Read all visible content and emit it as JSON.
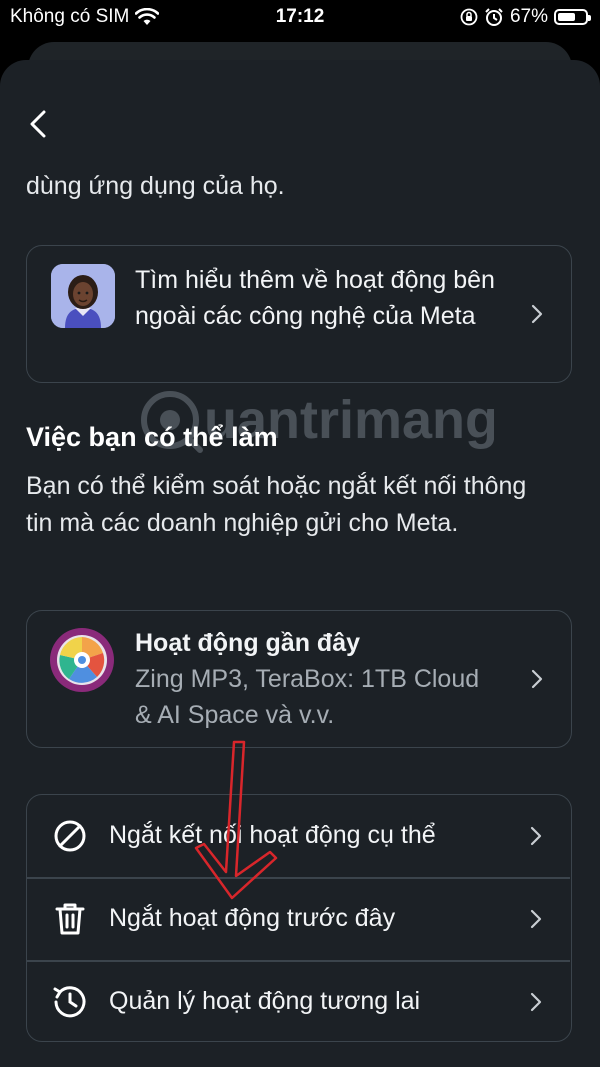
{
  "status_bar": {
    "carrier": "Không có SIM",
    "time": "17:12",
    "battery_percent": "67%",
    "battery_level": 0.67,
    "icons": [
      "wifi-icon",
      "rotation-lock-icon",
      "alarm-icon",
      "battery-icon"
    ]
  },
  "nav": {
    "back_icon": "chevron-left-icon"
  },
  "previous_text": "dùng ứng dụng của họ.",
  "learn_card": {
    "text": "Tìm hiểu thêm về hoạt động bên ngoài các công nghệ của Meta",
    "icon": "person-avatar-icon"
  },
  "section": {
    "title": "Việc bạn có thể làm",
    "description": "Bạn có thể kiểm soát hoặc ngắt kết nối thông tin mà các doanh nghiệp gửi cho Meta."
  },
  "recent_card": {
    "title": "Hoạt động gần đây",
    "subtitle": "Zing MP3, TeraBox: 1TB Cloud & AI Space và v.v.",
    "icon": "app-wheel-icon"
  },
  "options": [
    {
      "label": "Ngắt kết nối hoạt động cụ thể",
      "icon": "block-icon"
    },
    {
      "label": "Ngắt hoạt động trước đây",
      "icon": "trash-icon"
    },
    {
      "label": "Quản lý hoạt động tương lai",
      "icon": "clock-history-icon"
    }
  ],
  "watermark": "uantrimang",
  "colors": {
    "background": "#1c2126",
    "card_border": "#3b444c",
    "secondary_text": "#a6adb4",
    "annotation_arrow": "#d8262b"
  }
}
